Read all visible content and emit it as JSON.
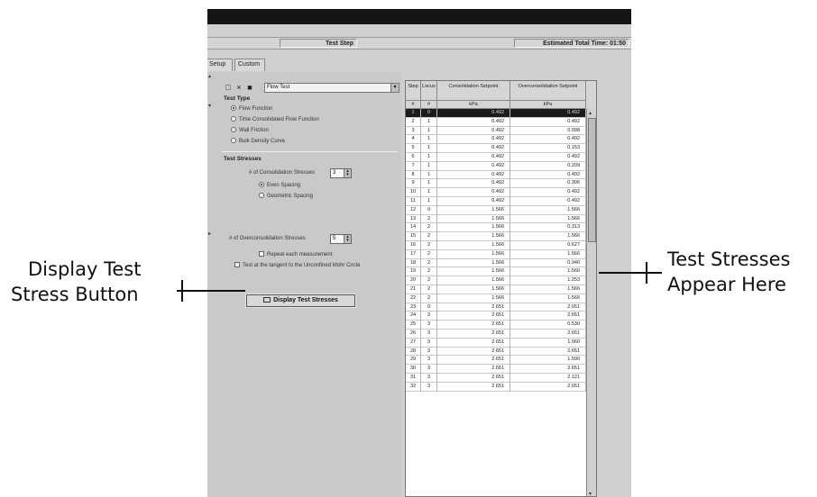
{
  "window": {
    "status_test_step": "Test Step",
    "status_estimated": "Estimated Total Time: 01:50"
  },
  "tabs": [
    "Setup",
    "Custom"
  ],
  "left_panel": {
    "preset_value": "Flow Test",
    "test_type_title": "Test Type",
    "test_type_options": [
      {
        "label": "Flow Function",
        "selected": true
      },
      {
        "label": "Time Consolidated Flow Function",
        "selected": false
      },
      {
        "label": "Wall Friction",
        "selected": false
      },
      {
        "label": "Bulk Density Curve",
        "selected": false
      }
    ],
    "test_stresses_title": "Test Stresses",
    "consolidation_label": "# of Consolidation Stresses",
    "consolidation_value": "3",
    "spacing_options": [
      {
        "label": "Even Spacing",
        "selected": true
      },
      {
        "label": "Geometric Spacing",
        "selected": false
      }
    ],
    "overconsolidation_label": "# of Overconsolidation Stresses",
    "overconsolidation_value": "5",
    "repeat_label": "Repeat each measurement",
    "tangent_label": "Test at the tangent to the Unconfined Mohr Circle",
    "display_button_label": "Display Test Stresses"
  },
  "grid": {
    "columns": [
      "Step",
      "Locus",
      "Consolidation Setpoint",
      "Overconsolidation Setpoint"
    ],
    "units": [
      "#",
      "#",
      "kPa",
      "kPa"
    ],
    "rows": [
      [
        "1",
        "0",
        "0.492",
        "0.492"
      ],
      [
        "2",
        "1",
        "0.492",
        "0.492"
      ],
      [
        "3",
        "1",
        "0.492",
        "0.098"
      ],
      [
        "4",
        "1",
        "0.492",
        "0.492"
      ],
      [
        "5",
        "1",
        "0.492",
        "0.153"
      ],
      [
        "6",
        "1",
        "0.492",
        "0.492"
      ],
      [
        "7",
        "1",
        "0.492",
        "0.209"
      ],
      [
        "8",
        "1",
        "0.492",
        "0.492"
      ],
      [
        "9",
        "1",
        "0.492",
        "0.306"
      ],
      [
        "10",
        "1",
        "0.492",
        "0.492"
      ],
      [
        "11",
        "1",
        "0.492",
        "0.492"
      ],
      [
        "12",
        "0",
        "1.566",
        "1.566"
      ],
      [
        "13",
        "2",
        "1.566",
        "1.566"
      ],
      [
        "14",
        "2",
        "1.566",
        "0.313"
      ],
      [
        "15",
        "2",
        "1.566",
        "1.566"
      ],
      [
        "16",
        "2",
        "1.566",
        "0.627"
      ],
      [
        "17",
        "2",
        "1.566",
        "1.566"
      ],
      [
        "18",
        "2",
        "1.566",
        "0.940"
      ],
      [
        "19",
        "2",
        "1.566",
        "1.566"
      ],
      [
        "20",
        "2",
        "1.566",
        "1.253"
      ],
      [
        "21",
        "2",
        "1.566",
        "1.566"
      ],
      [
        "22",
        "2",
        "1.566",
        "1.566"
      ],
      [
        "23",
        "0",
        "2.651",
        "2.651"
      ],
      [
        "24",
        "3",
        "2.651",
        "2.651"
      ],
      [
        "25",
        "3",
        "2.651",
        "0.530"
      ],
      [
        "26",
        "3",
        "2.651",
        "2.651"
      ],
      [
        "27",
        "3",
        "2.651",
        "1.060"
      ],
      [
        "28",
        "3",
        "2.651",
        "2.651"
      ],
      [
        "29",
        "3",
        "2.651",
        "1.590"
      ],
      [
        "30",
        "3",
        "2.651",
        "2.651"
      ],
      [
        "31",
        "3",
        "2.651",
        "2.121"
      ],
      [
        "32",
        "3",
        "2.651",
        "2.651"
      ]
    ],
    "selected_row": 0
  },
  "callouts": {
    "left_line1": "Display Test",
    "left_line2": "Stress Button",
    "right_line1": "Test Stresses",
    "right_line2": "Appear Here"
  }
}
